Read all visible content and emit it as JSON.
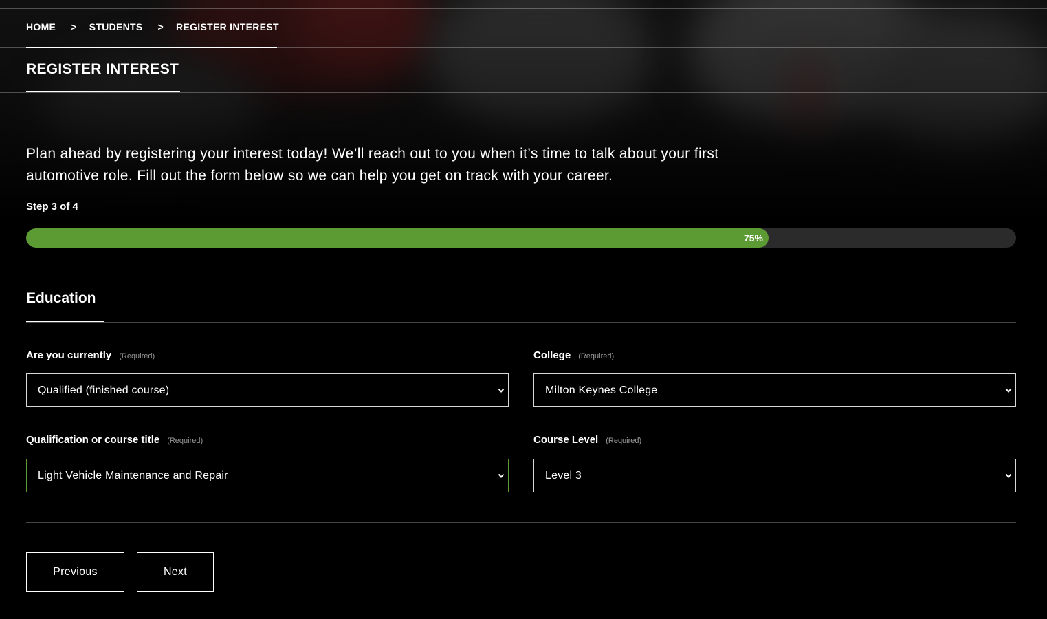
{
  "breadcrumb": {
    "items": [
      "HOME",
      "STUDENTS",
      "REGISTER INTEREST"
    ],
    "separator": ">"
  },
  "page_title": "REGISTER INTEREST",
  "intro_text": "Plan ahead by registering your interest today! We’ll reach out to you when it’s time to talk about your first automotive role. Fill out the form below so we can help you get on track with your career.",
  "progress": {
    "step_label": "Step 3 of 4",
    "percent_label": "75%",
    "fraction": 0.75
  },
  "section": {
    "title": "Education"
  },
  "fields": {
    "status": {
      "label": "Are you currently",
      "required": "(Required)",
      "value": "Qualified (finished course)"
    },
    "college": {
      "label": "College",
      "required": "(Required)",
      "value": "Milton Keynes College"
    },
    "qualification": {
      "label": "Qualification or course title",
      "required": "(Required)",
      "value": "Light Vehicle Maintenance and Repair"
    },
    "course_level": {
      "label": "Course Level",
      "required": "(Required)",
      "value": "Level 3"
    }
  },
  "buttons": {
    "previous": "Previous",
    "next": "Next"
  },
  "colors": {
    "accent": "#5c9a33",
    "background": "#000000",
    "track": "#2b2b2b"
  },
  "icons": {
    "select_arrow": "chevron-down-icon"
  }
}
